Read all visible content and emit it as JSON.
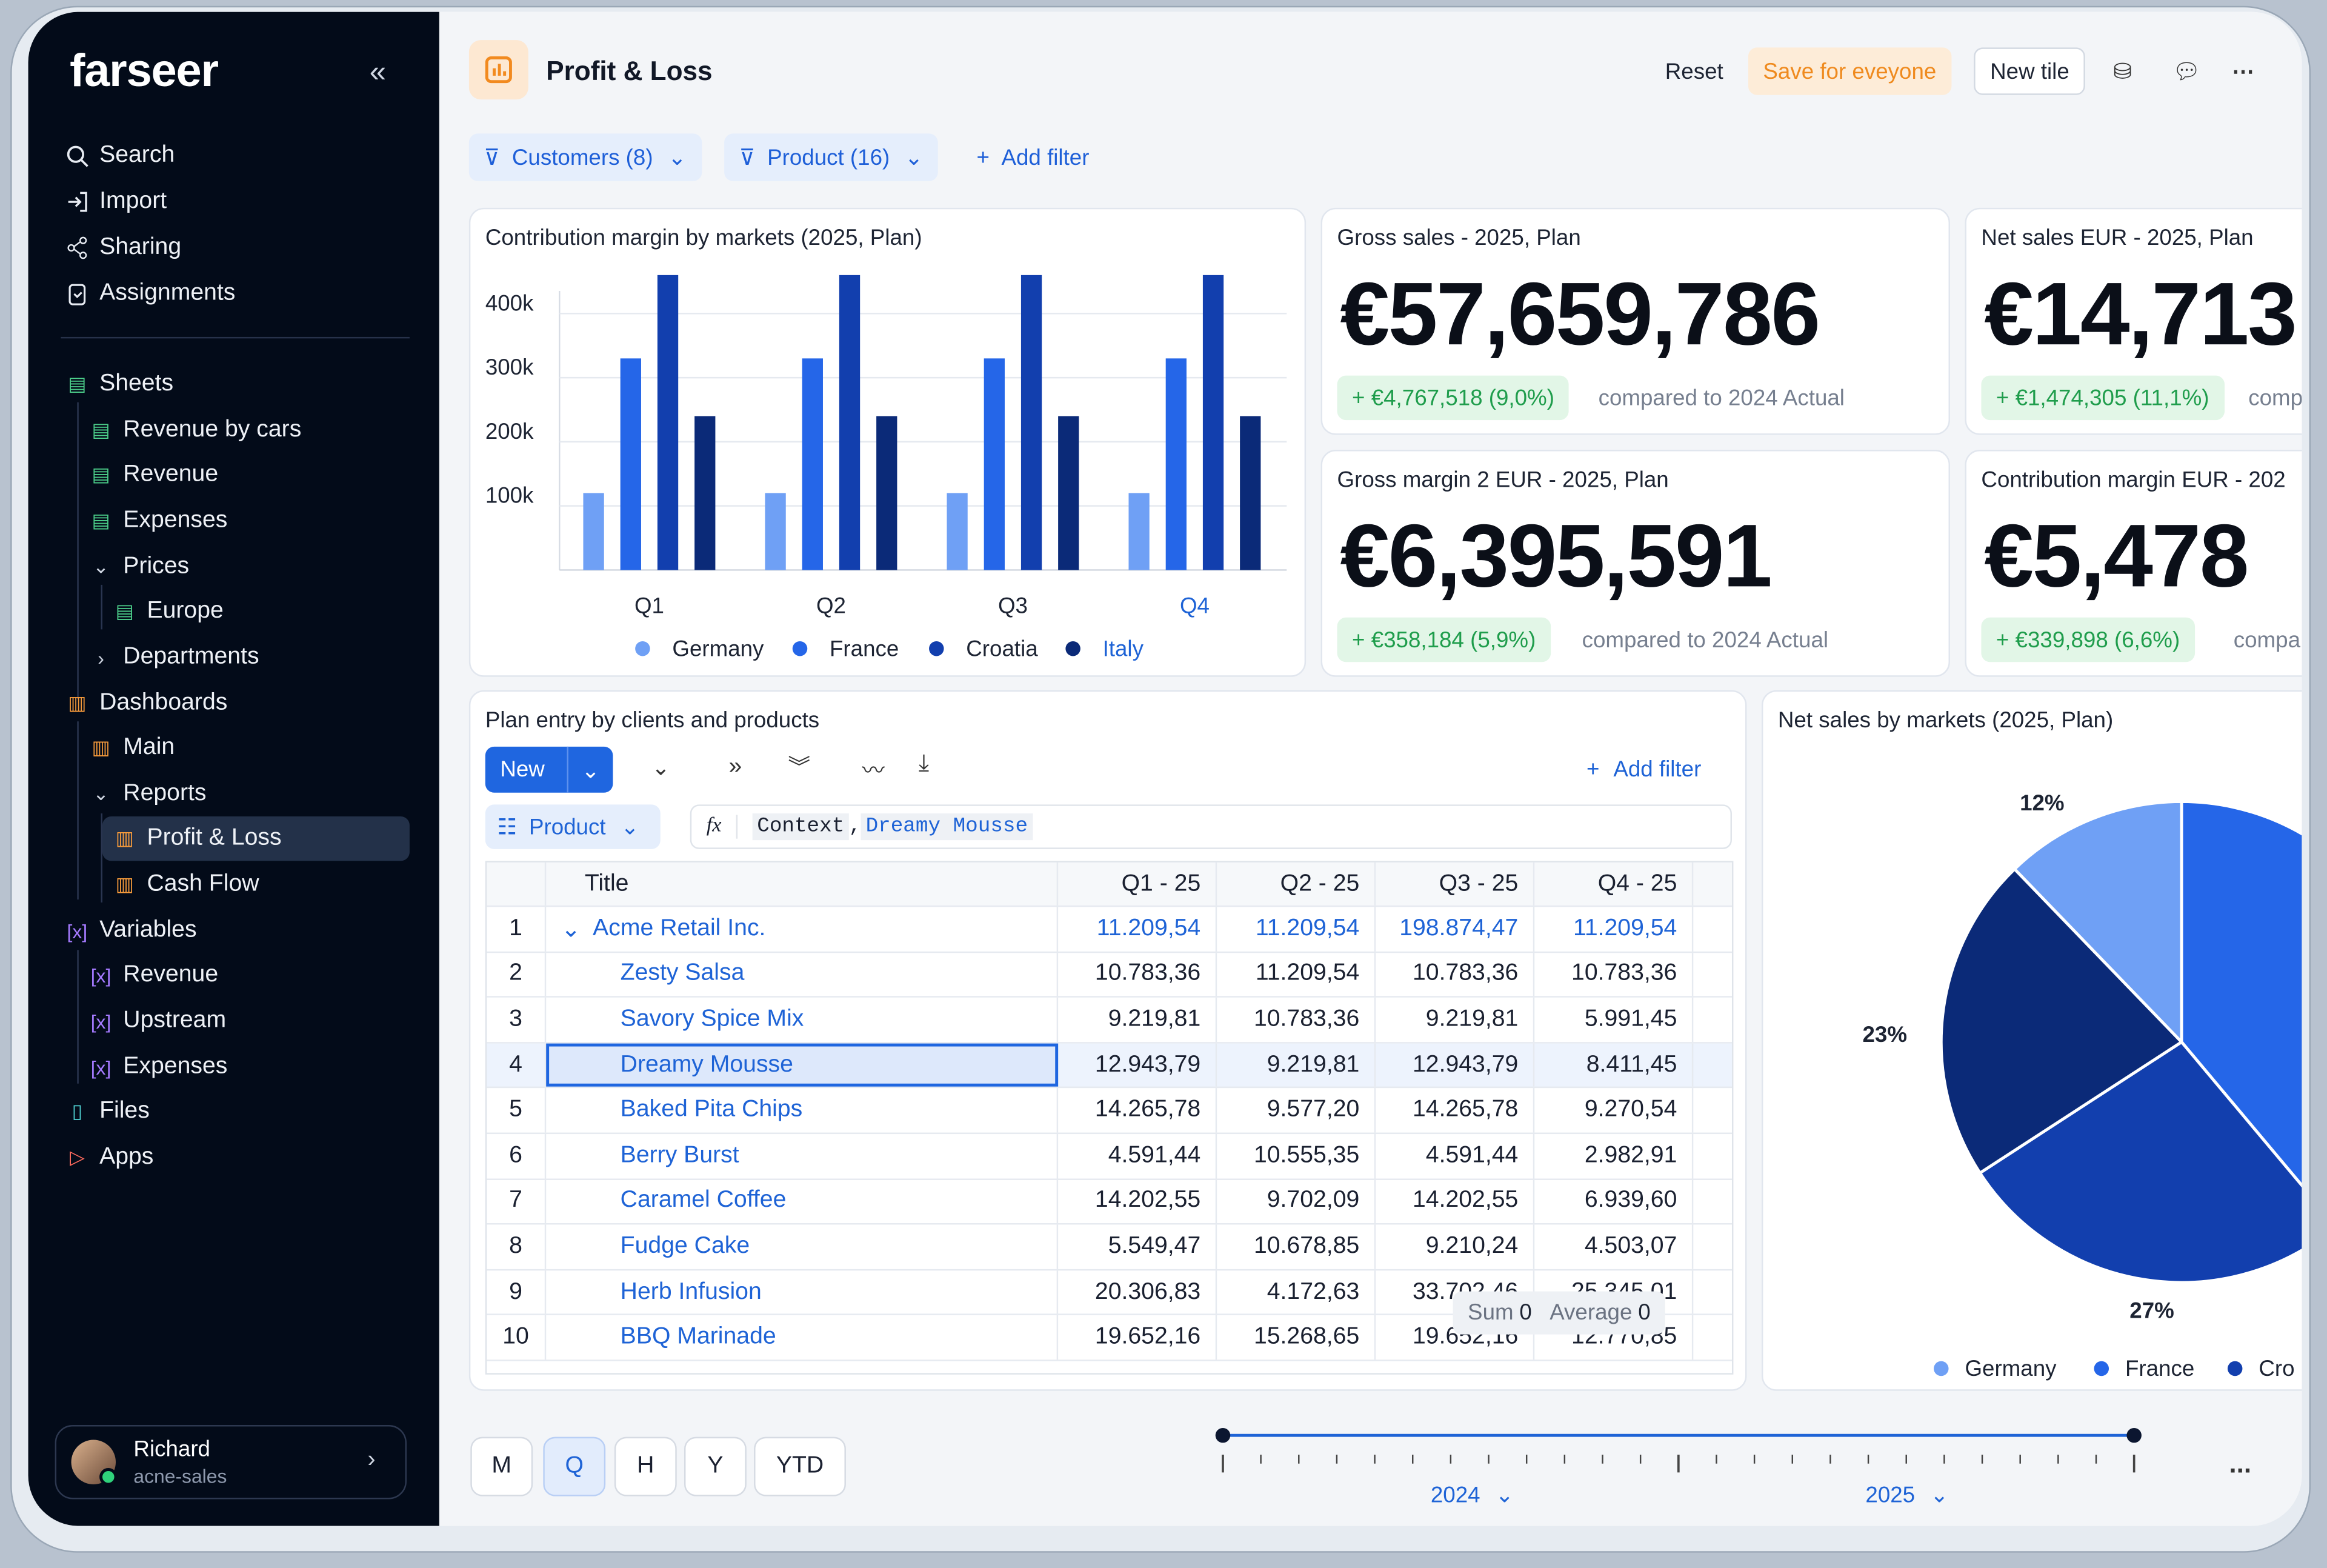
{
  "app": {
    "logo": "farseer",
    "collapse_icon": "chevrons-left-icon"
  },
  "sidebar": {
    "top": [
      {
        "label": "Search",
        "icon": "search-icon"
      },
      {
        "label": "Import",
        "icon": "import-icon"
      },
      {
        "label": "Sharing",
        "icon": "share-icon"
      },
      {
        "label": "Assignments",
        "icon": "clipboard-icon"
      }
    ],
    "tree": {
      "sheets": "Sheets",
      "revenue_by_cars": "Revenue by cars",
      "revenue": "Revenue",
      "expenses": "Expenses",
      "prices": "Prices",
      "europe": "Europe",
      "departments": "Departments",
      "dashboards": "Dashboards",
      "main": "Main",
      "reports": "Reports",
      "profit_loss": "Profit & Loss",
      "cash_flow": "Cash Flow",
      "variables": "Variables",
      "var_revenue": "Revenue",
      "var_upstream": "Upstream",
      "var_expenses": "Expenses",
      "files": "Files",
      "apps": "Apps"
    },
    "user": {
      "name": "Richard",
      "org": "acne-sales"
    }
  },
  "header": {
    "title": "Profit & Loss",
    "reset": "Reset",
    "save": "Save for eveyone",
    "new_tile": "New tile",
    "accent": "#f59a3b"
  },
  "filters": {
    "customers": "Customers (8)",
    "product": "Product (16)",
    "add": "Add filter"
  },
  "bar_card": {
    "title": "Contribution margin by markets (2025, Plan)"
  },
  "chart_data": [
    {
      "type": "bar",
      "title": "Contribution margin by markets (2025, Plan)",
      "categories": [
        "Q1",
        "Q2",
        "Q3",
        "Q4"
      ],
      "ylim": [
        0,
        470000
      ],
      "yticks": [
        "100k",
        "200k",
        "300k",
        "400k"
      ],
      "series": [
        {
          "name": "Germany",
          "color": "#6fa0f5",
          "values": [
            120000,
            120000,
            120000,
            120000
          ]
        },
        {
          "name": "France",
          "color": "#2566e8",
          "values": [
            330000,
            330000,
            330000,
            330000
          ]
        },
        {
          "name": "Croatia",
          "color": "#123fae",
          "values": [
            460000,
            460000,
            460000,
            460000
          ]
        },
        {
          "name": "Italy",
          "color": "#0b2a78",
          "values": [
            240000,
            240000,
            240000,
            240000
          ]
        }
      ],
      "legend": "bottom"
    },
    {
      "type": "pie",
      "title": "Net sales by markets (2025, Plan)",
      "labels": [
        "12%",
        "23%",
        "27%"
      ],
      "legend": [
        "Germany",
        "France",
        "Cro"
      ]
    }
  ],
  "kpis": [
    {
      "title": "Gross sales - 2025, Plan",
      "value": "€57,659,786",
      "delta": "+ €4,767,518 (9,0%)",
      "compare": "compared to 2024 Actual"
    },
    {
      "title": "Net sales EUR - 2025, Plan",
      "value": "€14,713",
      "delta": "+ €1,474,305 (11,1%)",
      "compare": "comp"
    },
    {
      "title": "Gross margin 2 EUR - 2025, Plan",
      "value": "€6,395,591",
      "delta": "+ €358,184 (5,9%)",
      "compare": "compared to 2024 Actual"
    },
    {
      "title": "Contribution margin EUR - 202",
      "value": "€5,478",
      "delta": "+ €339,898 (6,6%)",
      "compare": "compa"
    }
  ],
  "table_card": {
    "title": "Plan entry by clients and products",
    "new": "New",
    "add_filter": "Add filter",
    "product_dim": "Product",
    "formula_context": "Context",
    "formula_sep": ",",
    "formula_value": "Dreamy Mousse",
    "headers": [
      "Title",
      "Q1 - 25",
      "Q2 - 25",
      "Q3 - 25",
      "Q4 - 25"
    ],
    "rows": [
      {
        "n": "1",
        "title": "Acme Retail Inc.",
        "q1": "11.209,54",
        "q2": "11.209,54",
        "q3": "198.874,47",
        "q4": "11.209,54"
      },
      {
        "n": "2",
        "title": "Zesty Salsa",
        "q1": "10.783,36",
        "q2": "11.209,54",
        "q3": "10.783,36",
        "q4": "10.783,36"
      },
      {
        "n": "3",
        "title": "Savory Spice Mix",
        "q1": "9.219,81",
        "q2": "10.783,36",
        "q3": "9.219,81",
        "q4": "5.991,45"
      },
      {
        "n": "4",
        "title": "Dreamy Mousse",
        "q1": "12.943,79",
        "q2": "9.219,81",
        "q3": "12.943,79",
        "q4": "8.411,45"
      },
      {
        "n": "5",
        "title": "Baked Pita Chips",
        "q1": "14.265,78",
        "q2": "9.577,20",
        "q3": "14.265,78",
        "q4": "9.270,54"
      },
      {
        "n": "6",
        "title": "Berry Burst",
        "q1": "4.591,44",
        "q2": "10.555,35",
        "q3": "4.591,44",
        "q4": "2.982,91"
      },
      {
        "n": "7",
        "title": "Caramel Coffee",
        "q1": "14.202,55",
        "q2": "9.702,09",
        "q3": "14.202,55",
        "q4": "6.939,60"
      },
      {
        "n": "8",
        "title": "Fudge Cake",
        "q1": "5.549,47",
        "q2": "10.678,85",
        "q3": "9.210,24",
        "q4": "4.503,07"
      },
      {
        "n": "9",
        "title": "Herb Infusion",
        "q1": "20.306,83",
        "q2": "4.172,63",
        "q3": "33.702,46",
        "q4": "25.345,01"
      },
      {
        "n": "10",
        "title": "BBQ Marinade",
        "q1": "19.652,16",
        "q2": "15.268,65",
        "q3": "19.652,16",
        "q4": "12.770,85"
      }
    ],
    "sum_label": "Sum",
    "sum_value": "0",
    "avg_label": "Average",
    "avg_value": "0"
  },
  "pie_card": {
    "title": "Net sales by markets (2025, Plan)"
  },
  "timeline": {
    "periods": [
      "M",
      "Q",
      "H",
      "Y",
      "YTD"
    ],
    "active": "Q",
    "year_a": "2024",
    "year_b": "2025",
    "more": "..."
  }
}
